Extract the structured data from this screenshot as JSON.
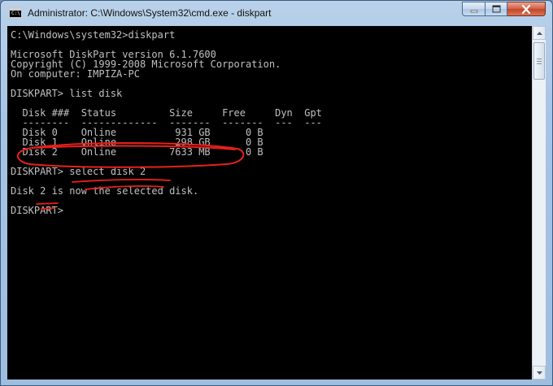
{
  "window": {
    "title": "Administrator: C:\\Windows\\System32\\cmd.exe - diskpart",
    "icon_name": "cmd-icon",
    "icon_glyph": "C:\\."
  },
  "console": {
    "lines": [
      "C:\\Windows\\system32>diskpart",
      "",
      "Microsoft DiskPart version 6.1.7600",
      "Copyright (C) 1999-2008 Microsoft Corporation.",
      "On computer: IMPIZA-PC",
      "",
      "DISKPART> list disk",
      "",
      "  Disk ###  Status         Size     Free     Dyn  Gpt",
      "  --------  -------------  -------  -------  ---  ---",
      "  Disk 0    Online          931 GB      0 B",
      "  Disk 1    Online          298 GB      0 B",
      "  Disk 2    Online         7633 MB      0 B",
      "",
      "DISKPART> select disk 2",
      "",
      "Disk 2 is now the selected disk.",
      "",
      "DISKPART> "
    ]
  },
  "colors": {
    "console_bg": "#000000",
    "console_text": "#c0c0c0",
    "annotation": "#e8201a"
  }
}
